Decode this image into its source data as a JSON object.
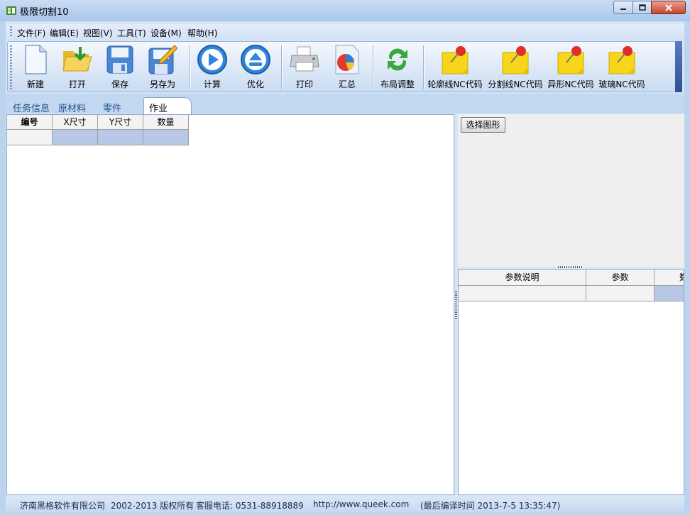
{
  "window": {
    "title": "极限切割10",
    "controls": {
      "minimize": "minimize-icon",
      "maximize": "maximize-icon",
      "close": "close-icon"
    }
  },
  "menu": [
    "文件(F)",
    "编辑(E)",
    "视图(V)",
    "工具(T)",
    "设备(M)",
    "帮助(H)"
  ],
  "toolbar": {
    "new": "新建",
    "open": "打开",
    "save": "保存",
    "save_as": "另存为",
    "compute": "计算",
    "optimize": "优化",
    "print": "打印",
    "summary": "汇总",
    "layout": "布局调整",
    "outline_nc": "轮廓线NC代码",
    "cutline_nc": "分割线NC代码",
    "shaped_nc": "异形NC代码",
    "glass_nc": "玻璃NC代码"
  },
  "tabs": {
    "task": "任务信息",
    "material": "原材料",
    "parts": "零件",
    "job": "作业",
    "active": "作业"
  },
  "job_grid": {
    "columns": [
      "编号",
      "X尺寸",
      "Y尺寸",
      "数量"
    ]
  },
  "right_panel": {
    "select_shape_button": "选择图形",
    "param_grid": {
      "columns": [
        "参数说明",
        "参数",
        "数"
      ]
    }
  },
  "status": {
    "company": "济南黑格软件有限公司",
    "copyright": "2002-2013 版权所有",
    "phone": "客服电话: 0531-88918889",
    "website": "http://www.queek.com",
    "build": "(最后编译时间 2013-7-5 13:35:47)"
  },
  "colors": {
    "titlebar": "#b8d0ee",
    "toolbar": "#d8e6f7",
    "selection": "#b8c8e6",
    "close": "#c8442c"
  }
}
